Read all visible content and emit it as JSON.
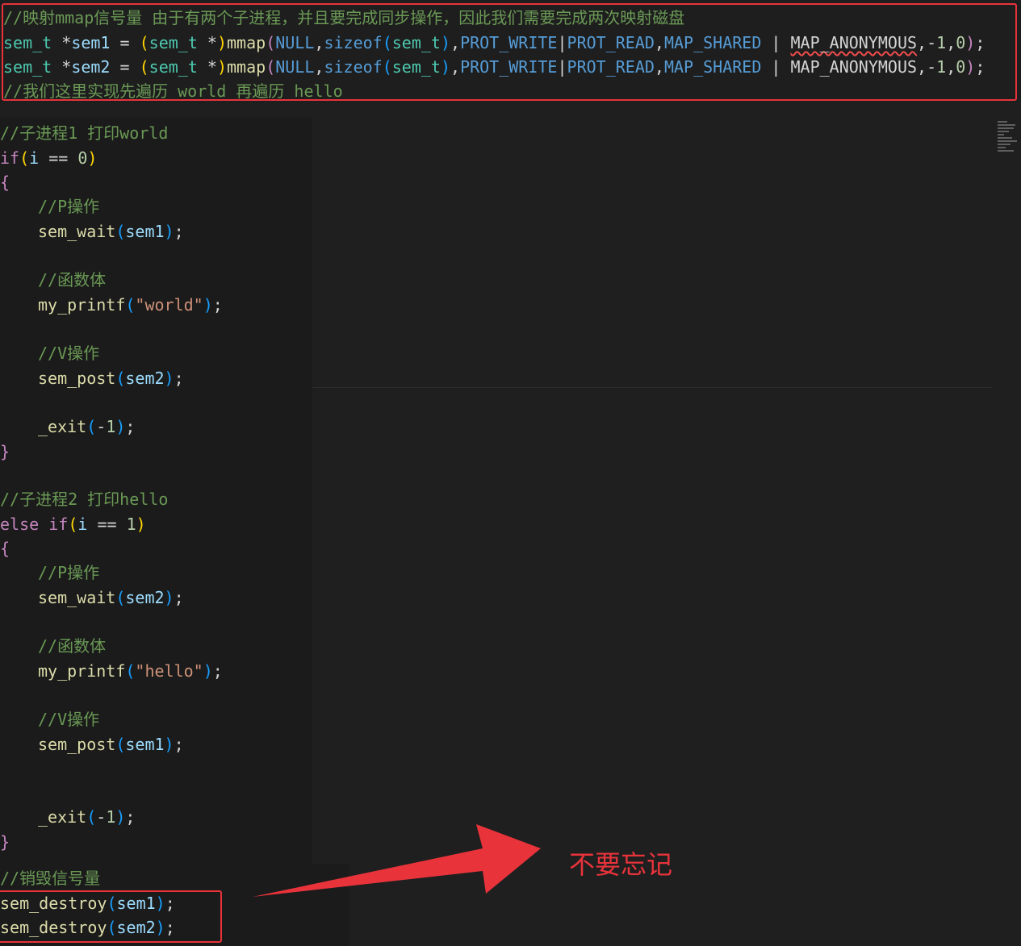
{
  "top": {
    "comment1": "//映射mmap信号量 由于有两个子进程，并且要完成同步操作，因此我们需要完成两次映射磁盘",
    "sem1_decl": "sem_t *sem1 = (sem_t *)mmap(NULL,sizeof(sem_t),PROT_WRITE|PROT_READ,MAP_SHARED | MAP_ANONYMOUS,-1,0);",
    "sem2_decl": "sem_t *sem2 = (sem_t *)mmap(NULL,sizeof(sem_t),PROT_WRITE|PROT_READ,MAP_SHARED | MAP_ANONYMOUS,-1,0);",
    "comment2": "//我们这里实现先遍历 world 再遍历 hello"
  },
  "child1": {
    "comment": "//子进程1 打印world",
    "cond": "if(i == 0)",
    "open": "{",
    "p_comment": "//P操作",
    "wait": "sem_wait(sem1);",
    "body_comment": "//函数体",
    "print": "my_printf(\"world\");",
    "v_comment": "//V操作",
    "post": "sem_post(sem2);",
    "exit": "_exit(-1);",
    "close": "}"
  },
  "child2": {
    "comment": "//子进程2 打印hello",
    "cond": "else if(i == 1)",
    "open": "{",
    "p_comment": "//P操作",
    "wait": "sem_wait(sem2);",
    "body_comment": "//函数体",
    "print": "my_printf(\"hello\");",
    "v_comment": "//V操作",
    "post": "sem_post(sem1);",
    "exit": "_exit(-1);",
    "close": "}"
  },
  "destroy": {
    "comment": "//销毁信号量",
    "sem1": "sem_destroy(sem1);",
    "sem2": "sem_destroy(sem2);"
  },
  "annotation": {
    "text": "不要忘记",
    "color": "#e8333b"
  },
  "icons": {
    "arrow": "arrow-icon",
    "minimap": "minimap-icon"
  }
}
